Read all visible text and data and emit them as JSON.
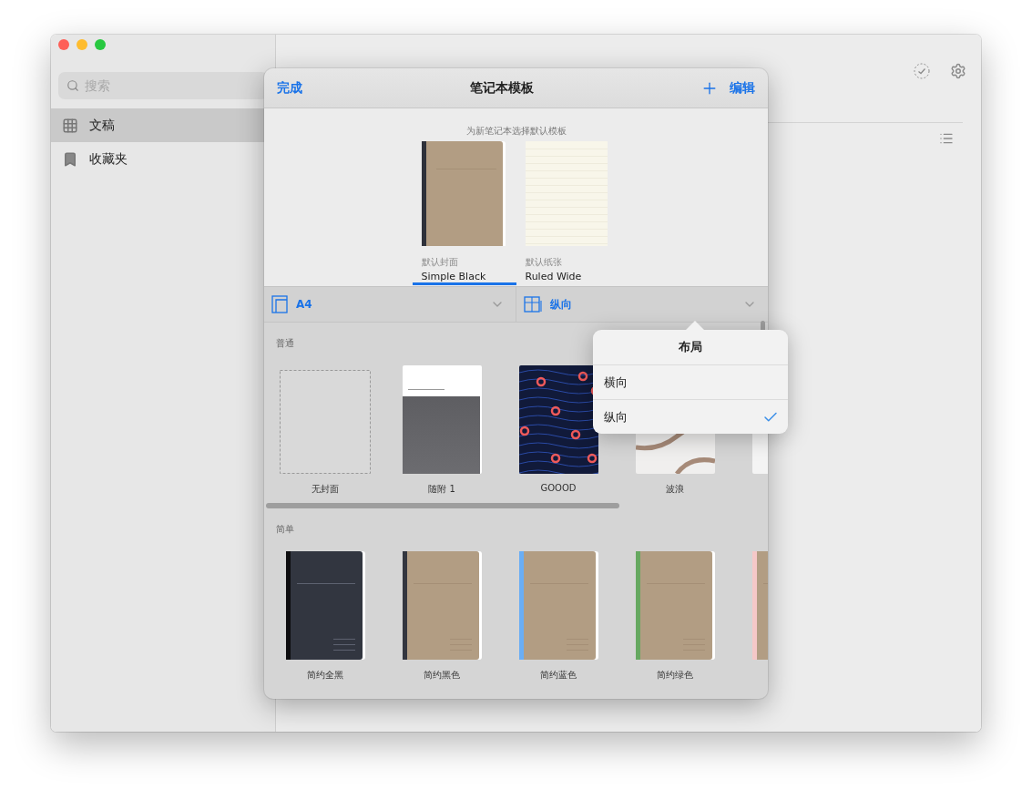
{
  "sidebar": {
    "search": {
      "placeholder": "搜索"
    },
    "items": [
      {
        "label": "文稿",
        "kind": "grid",
        "selected": true
      },
      {
        "label": "收藏夹",
        "kind": "bookmark",
        "selected": false
      }
    ]
  },
  "sheet": {
    "done": "完成",
    "title": "笔记本模板",
    "edit": "编辑",
    "defaults": {
      "caption": "为新笔记本选择默认模板",
      "items": [
        {
          "caption": "默认封面",
          "name": "Simple Black",
          "kind": "cover",
          "selected": true
        },
        {
          "caption": "默认纸张",
          "name": "Ruled Wide",
          "kind": "paper",
          "selected": false
        }
      ]
    },
    "selectors": [
      {
        "value": "A4",
        "kind": "size"
      },
      {
        "value": "纵向",
        "kind": "orientation"
      }
    ],
    "sections": [
      {
        "title": "普通",
        "items": [
          {
            "label": "无封面",
            "kind": "empty"
          },
          {
            "label": "随附 1",
            "kind": "gradient"
          },
          {
            "label": "GOOOD",
            "kind": "dots"
          },
          {
            "label": "波浪",
            "kind": "wave"
          },
          {
            "kind": "blank"
          }
        ]
      },
      {
        "title": "简单",
        "items": [
          {
            "label": "简约全黑",
            "kind": "dark",
            "color": "#0d0d0f"
          },
          {
            "label": "简约黑色",
            "kind": "kraft",
            "color": "#33363f"
          },
          {
            "label": "简约蓝色",
            "kind": "kraft",
            "color": "#6aaef5"
          },
          {
            "label": "简约绿色",
            "kind": "kraft",
            "color": "#66a860"
          },
          {
            "kind": "kraft",
            "color": "#f5c8c8"
          }
        ]
      }
    ]
  },
  "popover": {
    "title": "布局",
    "options": [
      {
        "label": "横向",
        "selected": false
      },
      {
        "label": "纵向",
        "selected": true
      }
    ]
  }
}
